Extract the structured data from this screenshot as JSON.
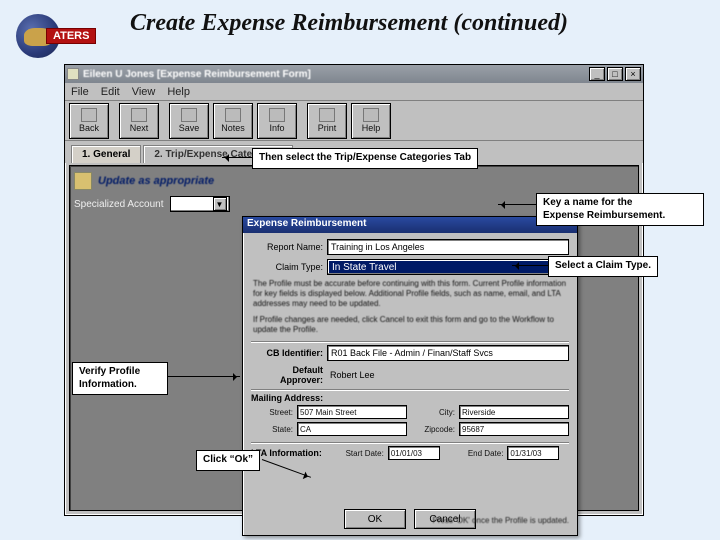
{
  "slide": {
    "title": "Create Expense Reimbursement (continued)",
    "logo_tag": "ATERS"
  },
  "window": {
    "title": "Eileen U Jones [Expense Reimbursement Form]",
    "menu": [
      "File",
      "Edit",
      "View",
      "Help"
    ],
    "toolbar": [
      {
        "label": "Back"
      },
      {
        "label": "Next"
      },
      {
        "label": "Save"
      },
      {
        "label": "Notes"
      },
      {
        "label": "Info"
      },
      {
        "label": "Print"
      },
      {
        "label": "Help"
      }
    ],
    "tabs": [
      {
        "label": "1. General",
        "active": true
      },
      {
        "label": "2. Trip/Expense Categories",
        "active": false
      }
    ],
    "update_text": "Update as appropriate",
    "specialized_label": "Specialized Account",
    "specialized_value": ""
  },
  "modal": {
    "title": "Expense Reimbursement",
    "report_name_label": "Report Name:",
    "report_name_value": "Training in Los Angeles",
    "claim_type_label": "Claim Type:",
    "claim_type_value": "In State Travel",
    "para1": "The Profile must be accurate before continuing with this form. Current Profile information for key fields is displayed below. Additional Profile fields, such as name, email, and LTA addresses may need to be updated.",
    "para2": "If Profile changes are needed, click Cancel to exit this form and go to the Workflow to update the Profile.",
    "cb_identifier_label": "CB Identifier:",
    "cb_identifier_value": "R01 Back File - Admin / Finan/Staff Svcs",
    "default_approver_label": "Default Approver:",
    "default_approver_value": "Robert Lee",
    "mailing_label": "Mailing Address:",
    "street_label": "Street:",
    "street_value": "507 Main Street",
    "city_label": "City:",
    "city_value": "Riverside",
    "state_label": "State:",
    "state_value": "CA",
    "zip_label": "Zipcode:",
    "zip_value": "95687",
    "lta_label": "LTA Information:",
    "start_label": "Start Date:",
    "start_value": "01/01/03",
    "end_label": "End Date:",
    "end_value": "01/31/03",
    "ok": "OK",
    "cancel": "Cancel",
    "press_note": "Press 'OK' once the Profile is updated."
  },
  "callouts": {
    "c1": "Then select the Trip/Expense Categories Tab",
    "c2a": "Key a name for the",
    "c2b": "Expense Reimbursement.",
    "c3": "Select a Claim Type.",
    "c4a": "Verify Profile",
    "c4b": "Information.",
    "c5": "Click “Ok”"
  }
}
